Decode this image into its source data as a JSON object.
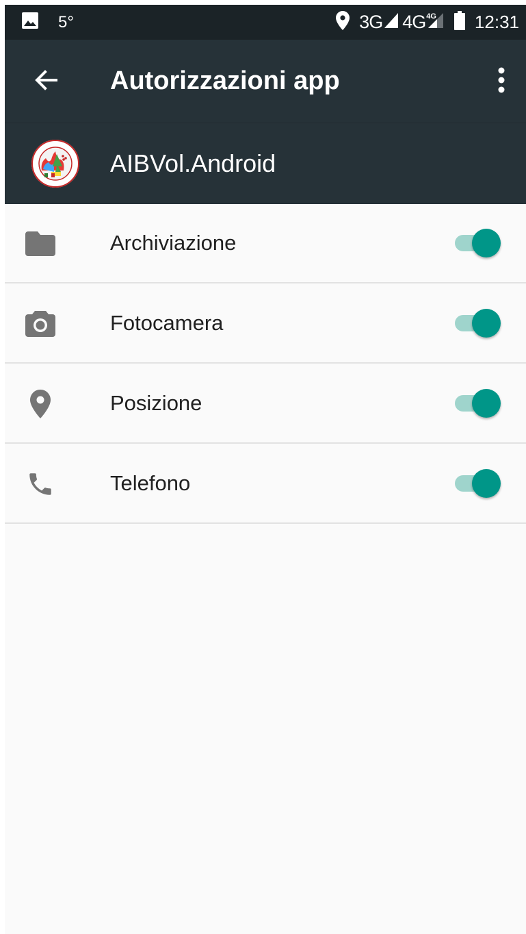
{
  "status_bar": {
    "temperature": "5°",
    "network_1": "3G",
    "network_2": "4G",
    "network_2_badge": "4G",
    "time": "12:31",
    "icons": [
      "image-notification-icon",
      "location-icon",
      "signal-icon",
      "signal-icon",
      "battery-icon"
    ]
  },
  "app_bar": {
    "title": "Autorizzazioni app",
    "back_icon": "arrow-back-icon",
    "menu_icon": "more-vert-icon"
  },
  "app": {
    "name": "AIBVol.Android",
    "logo_icon": "app-logo-icon"
  },
  "permissions": [
    {
      "label": "Archiviazione",
      "icon": "folder-icon",
      "enabled": true
    },
    {
      "label": "Fotocamera",
      "icon": "camera-icon",
      "enabled": true
    },
    {
      "label": "Posizione",
      "icon": "location-icon",
      "enabled": true
    },
    {
      "label": "Telefono",
      "icon": "phone-icon",
      "enabled": true
    }
  ],
  "colors": {
    "status_bar": "#1b2327",
    "app_bar": "#263238",
    "background": "#fafafa",
    "accent": "#009688",
    "accent_track": "#9fd4cc",
    "icon_grey": "#757575",
    "divider": "#e2e2e2"
  }
}
